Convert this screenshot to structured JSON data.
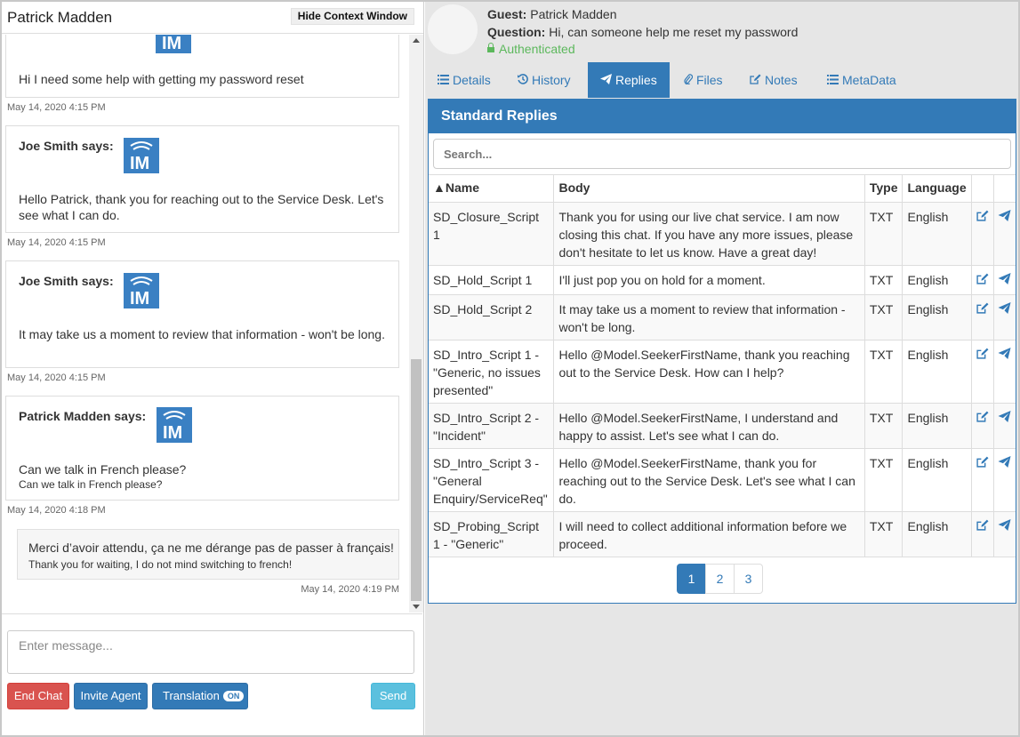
{
  "chat": {
    "title": "Patrick Madden",
    "hide_context_label": "Hide Context Window",
    "messages": [
      {
        "author": "",
        "text": "Hi I need some help with getting my password reset",
        "time": "May 14, 2020 4:15 PM"
      },
      {
        "author": "Joe Smith says:",
        "text": "Hello Patrick, thank you for reaching out to the Service Desk. Let's see what I can do.",
        "time": "May 14, 2020 4:15 PM"
      },
      {
        "author": "Joe Smith says:",
        "text": "It may take us a moment to review that information - won't be long.",
        "time": "May 14, 2020 4:15 PM"
      },
      {
        "author": "Patrick Madden says:",
        "text": "Can we talk in French please?",
        "translation": "Can we talk in French please?",
        "time": "May 14, 2020 4:18 PM"
      }
    ],
    "agent_reply": {
      "text": "Merci d’avoir attendu, ça ne me dérange pas de passer à français!",
      "translation": "Thank you for waiting, I do not mind switching to french!",
      "time": "May 14, 2020 4:19 PM"
    },
    "input_placeholder": "Enter message...",
    "buttons": {
      "end_chat": "End Chat",
      "invite_agent": "Invite Agent",
      "translation": "Translation",
      "translation_state": "ON",
      "send": "Send"
    }
  },
  "context": {
    "guest_label": "Guest:",
    "guest_name": "Patrick Madden",
    "question_label": "Question:",
    "question": "Hi, can someone help me reset my password",
    "auth_status": "Authenticated",
    "tabs": [
      {
        "label": "Details",
        "icon": "list-icon"
      },
      {
        "label": "History",
        "icon": "history-icon"
      },
      {
        "label": "Replies",
        "icon": "send-icon",
        "active": true
      },
      {
        "label": "Files",
        "icon": "paperclip-icon"
      },
      {
        "label": "Notes",
        "icon": "edit-icon"
      },
      {
        "label": "MetaData",
        "icon": "list-icon"
      }
    ],
    "replies": {
      "title": "Standard Replies",
      "search_placeholder": "Search...",
      "columns": [
        "▲Name",
        "Body",
        "Type",
        "Language"
      ],
      "rows": [
        {
          "name": "SD_Closure_Script 1",
          "body": "Thank you for using our live chat service. I am now closing this chat. If you have any more issues, please don't hesitate to let us know. Have a great day!",
          "type": "TXT",
          "language": "English"
        },
        {
          "name": "SD_Hold_Script 1",
          "body": "I'll just pop you on hold for a moment.",
          "type": "TXT",
          "language": "English"
        },
        {
          "name": "SD_Hold_Script 2",
          "body": "It may take us a moment to review that information - won't be long.",
          "type": "TXT",
          "language": "English"
        },
        {
          "name": "SD_Intro_Script 1 - \"Generic, no issues presented\"",
          "body": "Hello @Model.SeekerFirstName, thank you reaching out to the Service Desk. How can I help?",
          "type": "TXT",
          "language": "English"
        },
        {
          "name": "SD_Intro_Script 2 - \"Incident\"",
          "body": "Hello @Model.SeekerFirstName, I understand and happy to assist. Let's see what I can do.",
          "type": "TXT",
          "language": "English"
        },
        {
          "name": "SD_Intro_Script 3 - \"General Enquiry/ServiceReq\"",
          "body": "Hello @Model.SeekerFirstName, thank you for reaching out to the Service Desk. Let's see what I can do.",
          "type": "TXT",
          "language": "English"
        },
        {
          "name": "SD_Probing_Script 1 - \"Generic\"",
          "body": "I will need to collect additional information before we proceed.",
          "type": "TXT",
          "language": "English"
        }
      ],
      "pages": [
        "1",
        "2",
        "3"
      ],
      "current_page": "1"
    }
  },
  "colors": {
    "primary": "#337ab7",
    "danger": "#d9534f",
    "info": "#5bc0de",
    "success": "#5cb85c"
  }
}
